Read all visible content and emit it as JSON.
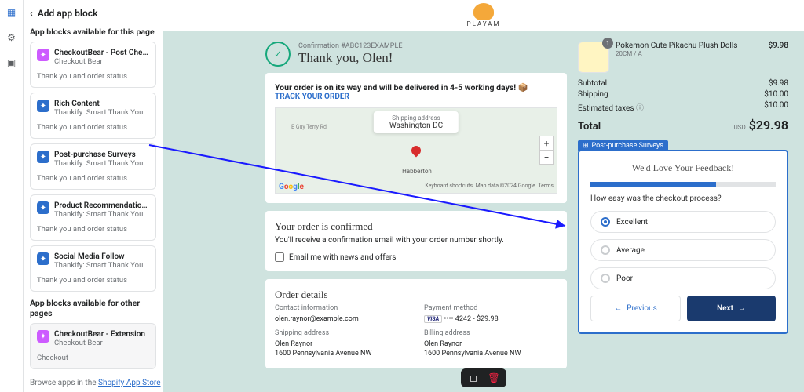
{
  "sidebar": {
    "title": "Add app block",
    "section1": "App blocks available for this page",
    "section2": "App blocks available for other pages",
    "blocks": [
      {
        "title": "CheckoutBear - Post Checkout",
        "sub": "Checkout Bear",
        "footer": "Thank you and order status",
        "icon": "pink"
      },
      {
        "title": "Rich Content",
        "sub": "Thankify: Smart Thank You ...",
        "footer": "Thank you and order status",
        "icon": "blue"
      },
      {
        "title": "Post-purchase Surveys",
        "sub": "Thankify: Smart Thank You ...",
        "footer": "Thank you and order status",
        "icon": "blue"
      },
      {
        "title": "Product Recommendations",
        "sub": "Thankify: Smart Thank You ...",
        "footer": "Thank you and order status",
        "icon": "blue"
      },
      {
        "title": "Social Media Follow",
        "sub": "Thankify: Smart Thank You ...",
        "footer": "Thank you and order status",
        "icon": "blue"
      }
    ],
    "ext": {
      "title": "CheckoutBear - Extension",
      "sub": "Checkout Bear",
      "footer": "Checkout"
    },
    "browse_pre": "Browse apps in the ",
    "browse_link": "Shopify App Store"
  },
  "logo": "PLAYAM",
  "thankyou": {
    "conf": "Confirmation #ABC123EXAMPLE",
    "ty": "Thank you, Olen!"
  },
  "onway": {
    "text": "Your order is on its way and will be delivered in 4-5 working days! 📦",
    "track": "TRACK YOUR ORDER"
  },
  "map": {
    "label": "Shipping address",
    "city": "Washington DC",
    "habberton": "Habberton",
    "road": "E Guy Terry Rd",
    "shortcuts": "Keyboard shortcuts",
    "mapdata": "Map data ©2024 Google",
    "terms": "Terms"
  },
  "confirmed": {
    "title": "Your order is confirmed",
    "msg": "You'll receive a confirmation email with your order number shortly.",
    "optin": "Email me with news and offers"
  },
  "details": {
    "title": "Order details",
    "contact_h": "Contact information",
    "email": "olen.raynor@example.com",
    "pay_h": "Payment method",
    "pay": "•••• 4242 - $29.98",
    "ship_h": "Shipping address",
    "name": "Olen Raynor",
    "addr": "1600 Pennsylvania Avenue NW",
    "bill_h": "Billing address"
  },
  "cart": {
    "item": {
      "title": "Pokemon Cute Pikachu Plush Dolls",
      "variant": "20CM / A",
      "price": "$9.98",
      "qty": "1"
    },
    "subtotal_l": "Subtotal",
    "subtotal_v": "$9.98",
    "ship_l": "Shipping",
    "ship_v": "$10.00",
    "tax_l": "Estimated taxes",
    "tax_v": "$10.00",
    "total_l": "Total",
    "usd": "USD",
    "total_v": "$29.98"
  },
  "survey": {
    "tag": "Post-purchase Surveys",
    "title": "We'd Love Your Feedback!",
    "q": "How easy was the checkout process?",
    "opt1": "Excellent",
    "opt2": "Average",
    "opt3": "Poor",
    "prev": "Previous",
    "next": "Next"
  }
}
